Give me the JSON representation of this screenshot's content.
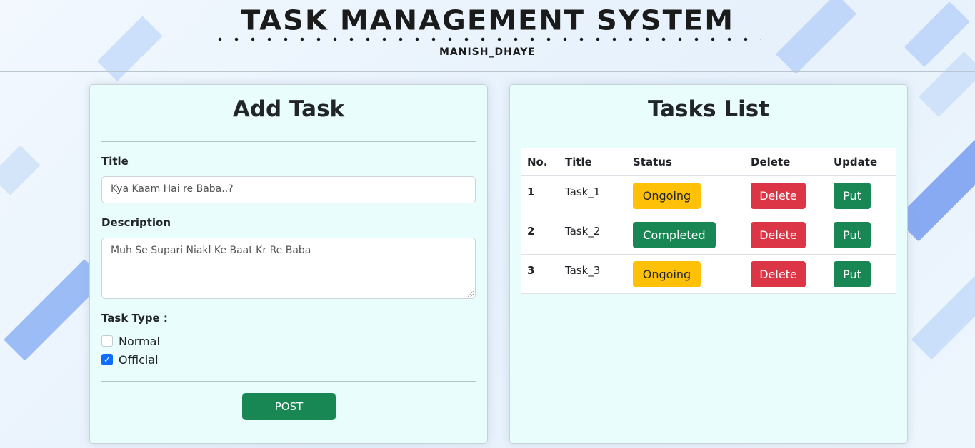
{
  "header": {
    "title": "TASK MANAGEMENT SYSTEM",
    "subtitle": "MANISH_DHAYE"
  },
  "add_task": {
    "title": "Add Task",
    "title_label": "Title",
    "title_value": "Kya Kaam Hai re Baba..?",
    "description_label": "Description",
    "description_value": "Muh Se Supari Niakl Ke Baat Kr Re Baba",
    "task_type_label": "Task Type :",
    "options": [
      {
        "label": "Normal",
        "checked": false
      },
      {
        "label": "Official",
        "checked": true
      }
    ],
    "post_label": "POST"
  },
  "tasks_list": {
    "title": "Tasks List",
    "columns": [
      "No.",
      "Title",
      "Status",
      "Delete",
      "Update"
    ],
    "rows": [
      {
        "no": "1",
        "title": "Task_1",
        "status": "Ongoing",
        "delete": "Delete",
        "update": "Put"
      },
      {
        "no": "2",
        "title": "Task_2",
        "status": "Completed",
        "delete": "Delete",
        "update": "Put"
      },
      {
        "no": "3",
        "title": "Task_3",
        "status": "Ongoing",
        "delete": "Delete",
        "update": "Put"
      }
    ]
  },
  "colors": {
    "ongoing": "#ffc107",
    "completed": "#198754",
    "delete": "#dc3545",
    "put": "#198754",
    "post": "#198754",
    "checkbox_checked": "#0d6efd"
  }
}
